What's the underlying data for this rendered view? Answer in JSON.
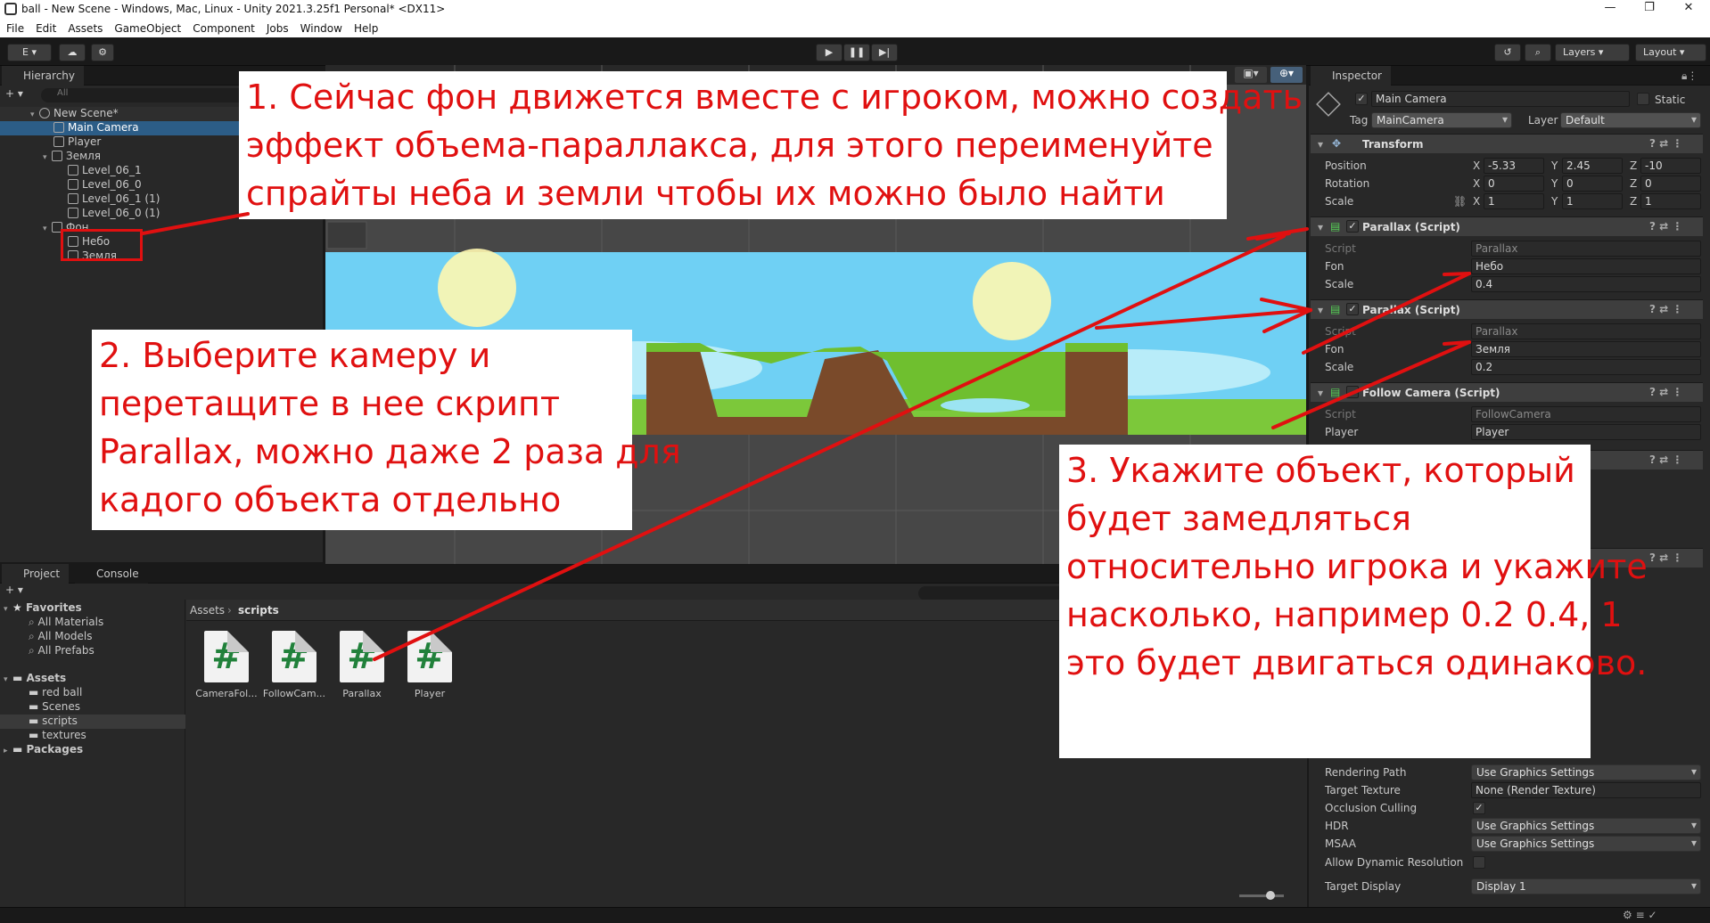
{
  "title_bar": {
    "title": "ball - New Scene - Windows, Mac, Linux - Unity 2021.3.25f1 Personal* <DX11>",
    "minimize": "—",
    "maximize": "❐",
    "close": "✕"
  },
  "menu": [
    "File",
    "Edit",
    "Assets",
    "GameObject",
    "Component",
    "Jobs",
    "Window",
    "Help"
  ],
  "toolbar": {
    "account": "E ▾",
    "layers": "Layers",
    "layout": "Layout",
    "play": "▶",
    "pause": "❚❚",
    "step": "▶|"
  },
  "hierarchy": {
    "tab": "Hierarchy",
    "search_placeholder": "All",
    "items": [
      {
        "label": "New Scene*"
      },
      {
        "label": "Main Camera"
      },
      {
        "label": "Player"
      },
      {
        "label": "Земля"
      },
      {
        "label": "Level_06_1"
      },
      {
        "label": "Level_06_0"
      },
      {
        "label": "Level_06_1 (1)"
      },
      {
        "label": "Level_06_0 (1)"
      },
      {
        "label": "Фон"
      },
      {
        "label": "Небо"
      },
      {
        "label": "Земля"
      }
    ]
  },
  "project": {
    "tabs": [
      "Project",
      "Console"
    ],
    "favorites": {
      "label": "Favorites",
      "items": [
        "All Materials",
        "All Models",
        "All Prefabs"
      ]
    },
    "assets": {
      "label": "Assets",
      "items": [
        "red ball",
        "Scenes",
        "scripts",
        "textures"
      ]
    },
    "packages": "Packages",
    "breadcrumb": [
      "Assets",
      "scripts"
    ],
    "files": [
      "CameraFol...",
      "FollowCam...",
      "Parallax",
      "Player"
    ]
  },
  "inspector": {
    "tab": "Inspector",
    "object_name": "Main Camera",
    "static_label": "Static",
    "tag_label": "Tag",
    "tag_value": "MainCamera",
    "layer_label": "Layer",
    "layer_value": "Default",
    "transform": {
      "title": "Transform",
      "position": {
        "label": "Position",
        "x": "-5.33",
        "y": "2.45",
        "z": "-10"
      },
      "rotation": {
        "label": "Rotation",
        "x": "0",
        "y": "0",
        "z": "0"
      },
      "scale": {
        "label": "Scale",
        "x": "1",
        "y": "1",
        "z": "1"
      },
      "axis_x": "X",
      "axis_y": "Y",
      "axis_z": "Z"
    },
    "parallax1": {
      "title": "Parallax (Script)",
      "script_label": "Script",
      "script_value": "Parallax",
      "fon_label": "Fon",
      "fon_value": "Небо",
      "scale_label": "Scale",
      "scale_value": "0.4"
    },
    "parallax2": {
      "title": "Parallax (Script)",
      "script_label": "Script",
      "script_value": "Parallax",
      "fon_label": "Fon",
      "fon_value": "Земля",
      "scale_label": "Scale",
      "scale_value": "0.2"
    },
    "follow": {
      "title": "Follow Camera (Script)",
      "script_label": "Script",
      "script_value": "FollowCamera",
      "player_label": "Player",
      "player_value": "Player"
    },
    "camera_rows": [
      {
        "label": "Rendering Path",
        "value": "Use Graphics Settings"
      },
      {
        "label": "Target Texture",
        "value": "None (Render Texture)"
      },
      {
        "label": "Occlusion Culling",
        "value": "✓"
      },
      {
        "label": "HDR",
        "value": "Use Graphics Settings"
      },
      {
        "label": "MSAA",
        "value": "Use Graphics Settings"
      },
      {
        "label": "Allow Dynamic Resolution",
        "value": ""
      },
      {
        "label": "Target Display",
        "value": "Display 1"
      }
    ]
  },
  "annotations": {
    "note1": [
      "1. Сейчас фон движется вместе с игроком, можно создать",
      "эффект объема-параллакса, для этого переименуйте",
      "спрайты неба и земли чтобы их можно было найти"
    ],
    "note2": [
      "2. Выберите камеру и",
      "перетащите в нее скрипт",
      "Parallax, можно даже 2 раза для",
      "кадого объекта отдельно"
    ],
    "note3": [
      "3. Укажите объект, который",
      "будет замедляться",
      "относительно игрока и укажите",
      "насколько, например 0.2 0.4, 1",
      "это будет двигаться одинаково."
    ]
  },
  "colors": {
    "selection": "#2c5d87",
    "annotation": "#e01010",
    "sky": "#6fd0f4",
    "grass": "#7cc83a"
  }
}
